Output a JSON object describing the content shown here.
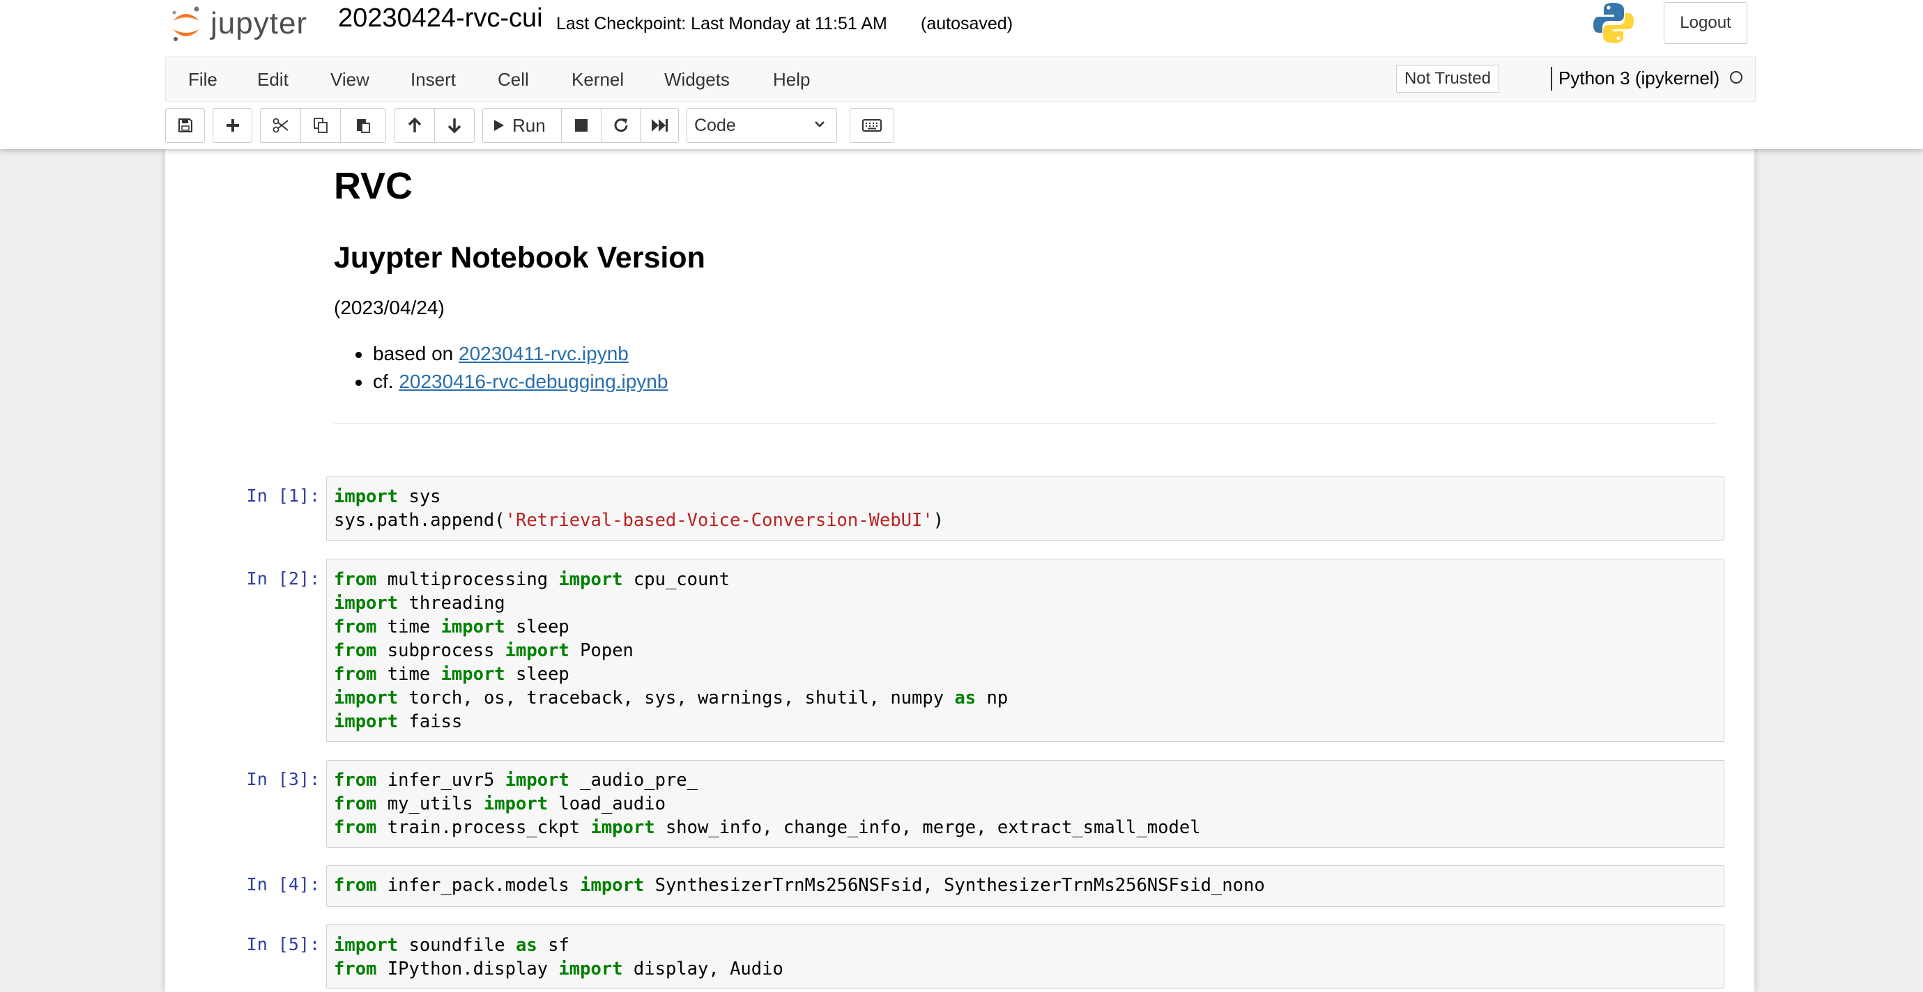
{
  "header": {
    "logo_text": "jupyter",
    "notebook_name": "20230424-rvc-cui",
    "checkpoint": "Last Checkpoint: Last Monday at 11:51 AM",
    "autosave": "(autosaved)",
    "logout_label": "Logout"
  },
  "menubar": {
    "items": [
      {
        "label": "File"
      },
      {
        "label": "Edit"
      },
      {
        "label": "View"
      },
      {
        "label": "Insert"
      },
      {
        "label": "Cell"
      },
      {
        "label": "Kernel"
      },
      {
        "label": "Widgets"
      },
      {
        "label": "Help"
      }
    ],
    "trusted_label": "Not Trusted",
    "kernel_name": "Python 3 (ipykernel)"
  },
  "toolbar": {
    "save_icon": "floppy-disk-icon",
    "insert_icon": "plus-icon",
    "cut_icon": "scissors-icon",
    "copy_icon": "copy-icon",
    "paste_icon": "paste-icon",
    "move_up_icon": "arrow-up-icon",
    "move_down_icon": "arrow-down-icon",
    "run_label": "Run",
    "run_icon": "play-icon",
    "interrupt_icon": "stop-icon",
    "restart_icon": "restart-icon",
    "run_all_icon": "fast-forward-icon",
    "cell_type": "Code",
    "keyboard_icon": "keyboard-icon"
  },
  "markdown": {
    "h1": "RVC",
    "h2": "Juypter Notebook Version",
    "date": "(2023/04/24)",
    "bullets": [
      {
        "prefix": "based on ",
        "link": "20230411-rvc.ipynb"
      },
      {
        "prefix": "cf. ",
        "link": "20230416-rvc-debugging.ipynb"
      }
    ]
  },
  "cells": [
    {
      "prompt": "In [1]:"
    },
    {
      "prompt": "In [2]:"
    },
    {
      "prompt": "In [3]:"
    },
    {
      "prompt": "In [4]:"
    },
    {
      "prompt": "In [5]:"
    }
  ],
  "code_tokens": {
    "import": "import",
    "from": "from",
    "as": "as",
    "c1_l1": " sys",
    "c1_l2a": "sys.path.append(",
    "c1_l2_str": "'Retrieval-based-Voice-Conversion-WebUI'",
    "c1_l2b": ")",
    "c2_l1a": " multiprocessing ",
    "c2_l1b": " cpu_count",
    "c2_l2": " threading",
    "c2_l3a": " time ",
    "c2_l3b": " sleep",
    "c2_l4a": " subprocess ",
    "c2_l4b": " Popen",
    "c2_l5a": " time ",
    "c2_l5b": " sleep",
    "c2_l6a": " torch, os, traceback, sys, warnings, shutil, numpy ",
    "c2_l6b": " np",
    "c2_l7": " faiss",
    "c3_l1a": " infer_uvr5 ",
    "c3_l1b": " _audio_pre_",
    "c3_l2a": " my_utils ",
    "c3_l2b": " load_audio",
    "c3_l3a": " train.process_ckpt ",
    "c3_l3b": " show_info, change_info, merge, extract_small_model",
    "c4_l1a": " infer_pack.models ",
    "c4_l1b": " SynthesizerTrnMs256NSFsid, SynthesizerTrnMs256NSFsid_nono",
    "c5_l1a": " soundfile ",
    "c5_l1b": " sf",
    "c5_l2a": " IPython.display ",
    "c5_l2b": " display, Audio"
  }
}
